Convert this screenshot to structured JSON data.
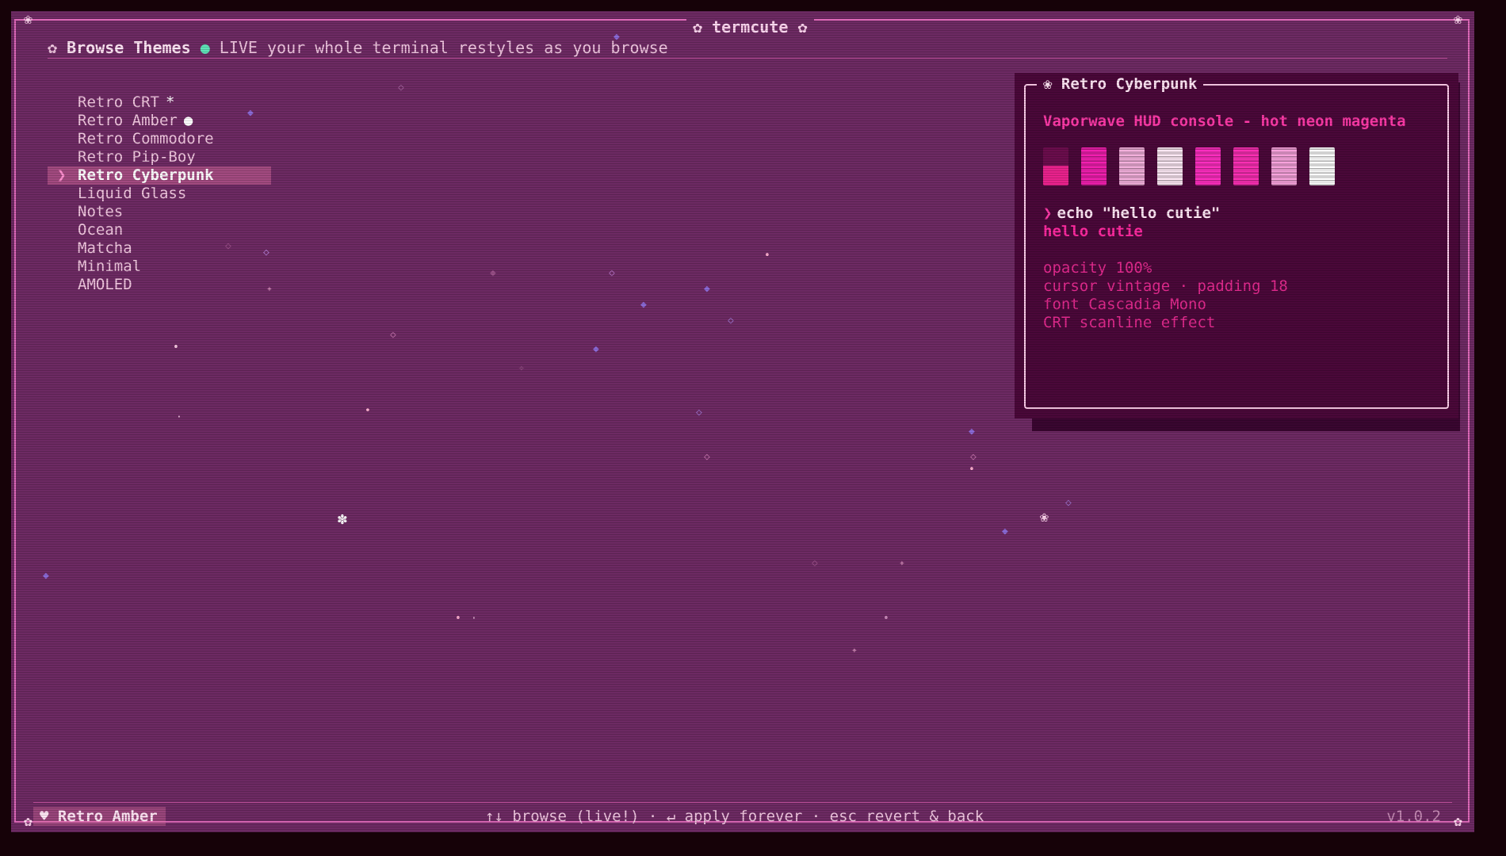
{
  "app": {
    "title": "✿ termcute ✿",
    "version": "v1.0.2"
  },
  "header": {
    "icon": "✿",
    "title": "Browse Themes",
    "live_dot": "●",
    "live_label": "LIVE",
    "live_text": "your whole terminal restyles as you browse"
  },
  "themes": [
    {
      "label": "Retro CRT",
      "tag": "*",
      "selected": false
    },
    {
      "label": "Retro Amber",
      "tag": "●",
      "selected": false
    },
    {
      "label": "Retro Commodore",
      "tag": "",
      "selected": false
    },
    {
      "label": "Retro Pip-Boy",
      "tag": "",
      "selected": false
    },
    {
      "label": "Retro Cyberpunk",
      "tag": "",
      "selected": true
    },
    {
      "label": "Liquid Glass",
      "tag": "",
      "selected": false
    },
    {
      "label": "Notes",
      "tag": "",
      "selected": false
    },
    {
      "label": "Ocean",
      "tag": "",
      "selected": false
    },
    {
      "label": "Matcha",
      "tag": "",
      "selected": false
    },
    {
      "label": "Minimal",
      "tag": "",
      "selected": false
    },
    {
      "label": "AMOLED",
      "tag": "",
      "selected": false
    }
  ],
  "selector_caret": "❯",
  "preview": {
    "title": "❀ Retro Cyberpunk",
    "description": "Vaporwave HUD console - hot neon magenta",
    "swatches": [
      "#6a0d4c",
      "#f21fb0",
      "#f3b0dc",
      "#fde8f4",
      "#ff2ec0",
      "#fb2fb4",
      "#f7a2dc",
      "#ffffff"
    ],
    "prompt": "❯",
    "command": "echo \"hello cutie\"",
    "output": "hello cutie",
    "info": [
      "opacity 100%",
      "cursor vintage · padding 18",
      "font Cascadia Mono",
      "CRT scanline effect"
    ]
  },
  "status": {
    "active_icon": "♥",
    "active_theme": "Retro Amber",
    "help": "↑↓ browse (live!) · ↵ apply forever · esc revert & back"
  },
  "colors": {
    "background": "#6d2a63",
    "frame": "#e06aba",
    "accent": "#ff3aa8",
    "live": "#5fe3b8"
  }
}
